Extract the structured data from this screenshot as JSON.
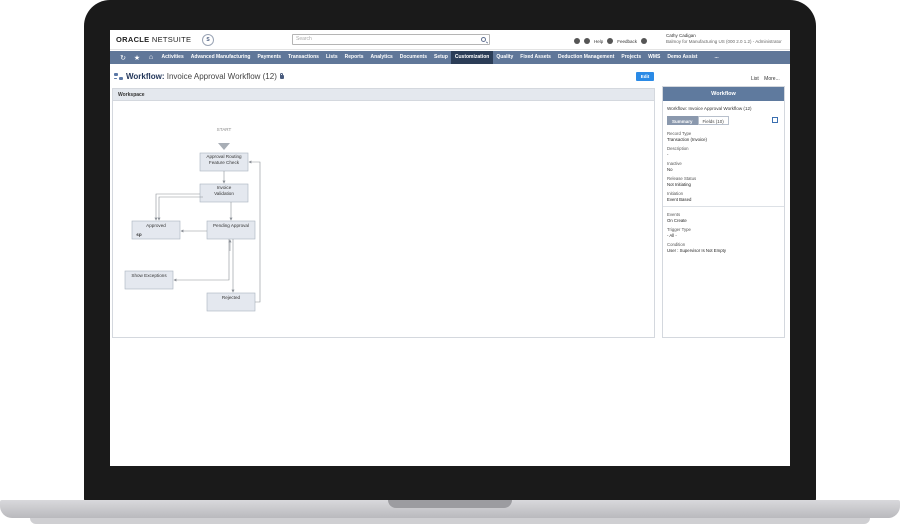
{
  "header": {
    "logo_part1": "ORACLE",
    "logo_part2": "NETSUITE",
    "logo_badge": "S",
    "search_placeholder": "Search",
    "tools": {
      "help": "Help",
      "feedback": "Feedback"
    },
    "user_name": "Cathy Cadigan",
    "user_role": "Balmoy for Manufacturing US (000 2.0 1.2) - Administrator"
  },
  "nav": {
    "items": [
      "Activities",
      "Advanced Manufacturing",
      "Payments",
      "Transactions",
      "Lists",
      "Reports",
      "Analytics",
      "Documents",
      "Setup",
      "Customization",
      "Quality",
      "Fixed Assets",
      "Deduction Management",
      "Projects",
      "WMS",
      "Demo Assist",
      "..."
    ],
    "active": "Customization"
  },
  "page": {
    "title_label": "Workflow:",
    "title_value": "Invoice Approval Workflow (12)",
    "edit_label": "Edit",
    "list_label": "List",
    "more_label": "More..."
  },
  "workspace": {
    "heading": "Workspace",
    "nodes": {
      "start": "START",
      "approval_routing_1": "Approval Routing",
      "approval_routing_2": "Feature Check",
      "invoice_validation_1": "Invoice",
      "invoice_validation_2": "Validation",
      "approved": "Approved",
      "pending_approval": "Pending Approval",
      "show_exceptions": "Show Exceptions",
      "rejected": "Rejected",
      "end_marker": "єр"
    }
  },
  "side_panel": {
    "heading": "Workflow",
    "title": "Workflow: Invoice Approval Workflow (12)",
    "tabs": [
      "Summary",
      "Fields (10)"
    ],
    "active_tab": "Summary",
    "props": [
      {
        "label": "Record Type",
        "value": "Transaction (Invoice)"
      },
      {
        "label": "Description",
        "value": "-"
      },
      {
        "label": "Inactive",
        "value": "No"
      },
      {
        "label": "Release Status",
        "value": "Not Initiating"
      },
      {
        "label": "Initiation",
        "value": "Event Based"
      }
    ],
    "props2": [
      {
        "label": "Events",
        "value": "On Create"
      },
      {
        "label": "Trigger Type",
        "value": "- All -"
      },
      {
        "label": "Condition",
        "value": "User : Supervisor Is Not Empty"
      }
    ]
  }
}
